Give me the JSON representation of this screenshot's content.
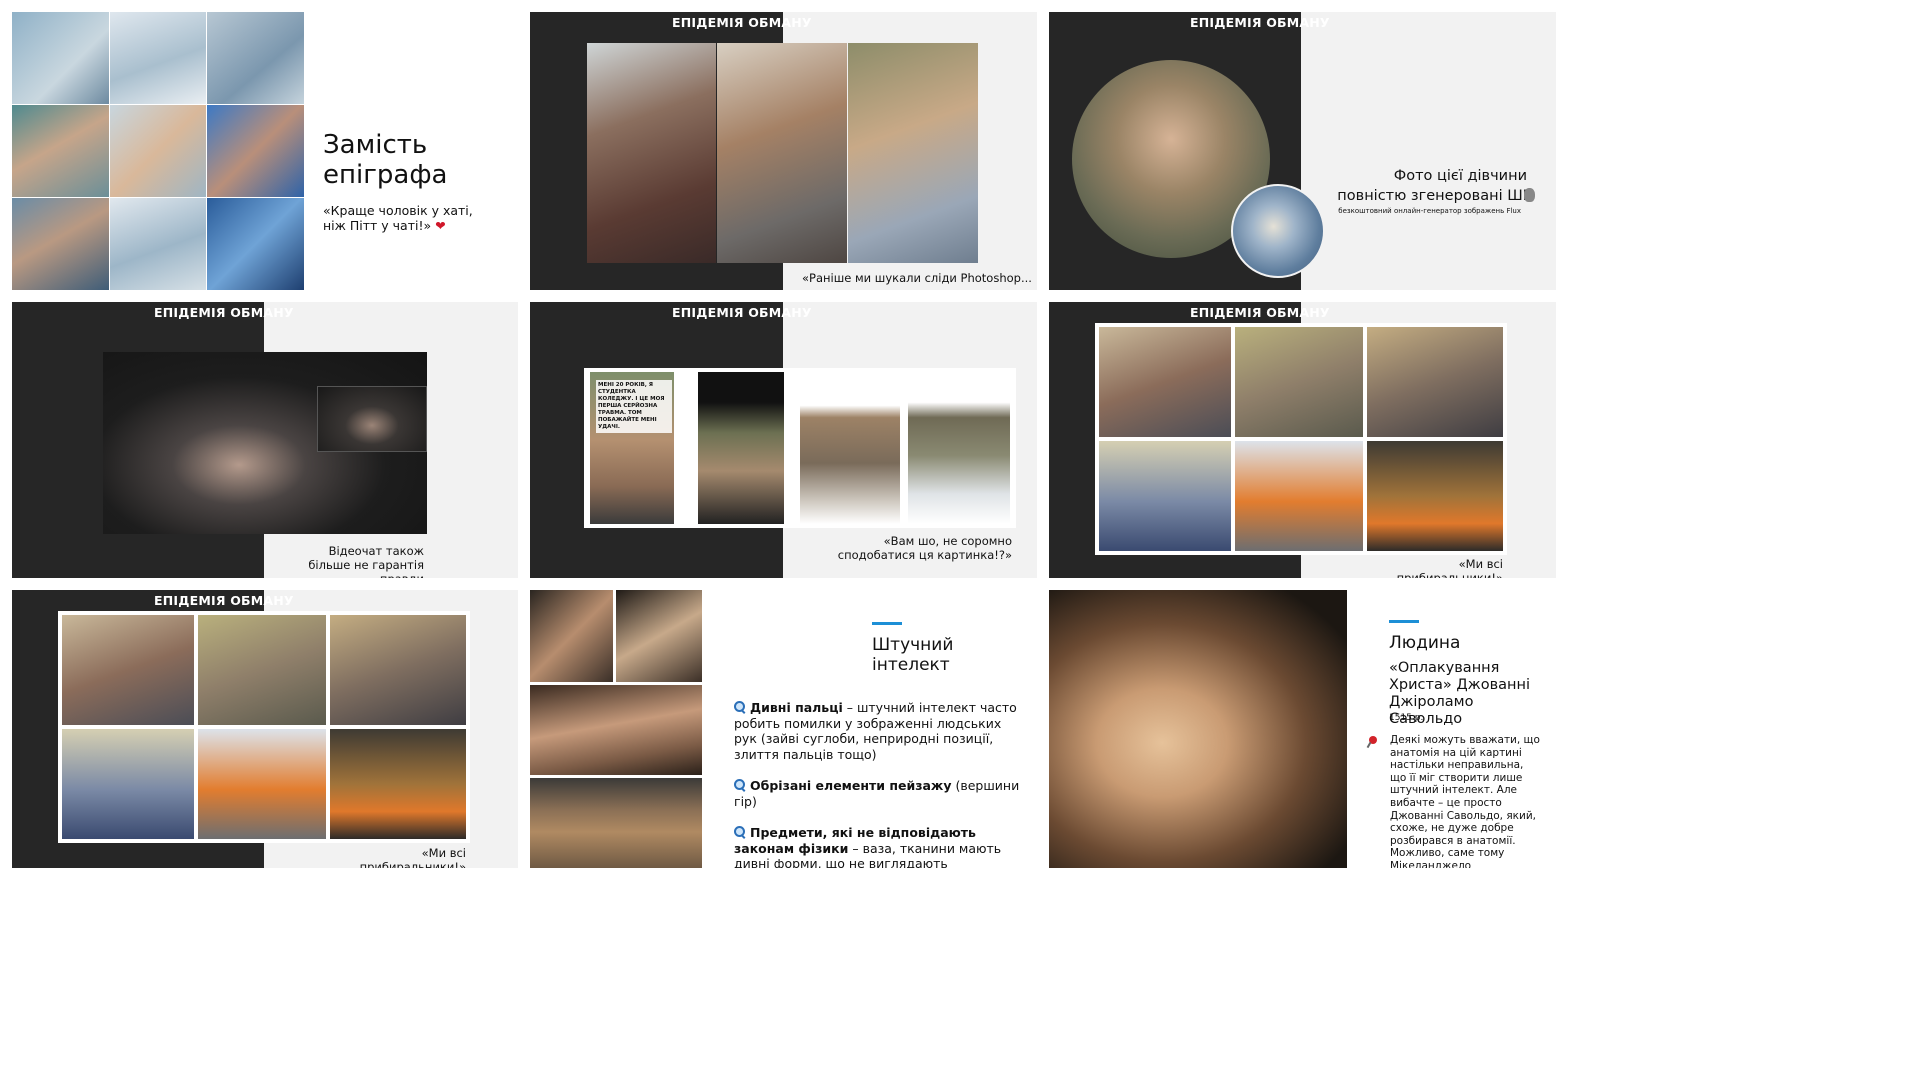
{
  "slides": {
    "s1": {
      "title": "Замість епіграфа",
      "quote": "«Краще чоловік у хаті, ніж Пітт у чаті!»",
      "heart": "❤"
    },
    "s2": {
      "header": "ЕПІДЕМІЯ ОБМАНУ",
      "caption": "«Раніше ми шукали сліди Photoshop..."
    },
    "s3": {
      "header": "ЕПІДЕМІЯ ОБМАНУ",
      "headline": "Фото цієї дівчини повністю згенеровані ШІ",
      "note": "безкоштовний онлайн-генератор зображень Flux"
    },
    "s4": {
      "header": "ЕПІДЕМІЯ ОБМАНУ",
      "caption": "Відеочат також більше не гарантія правди"
    },
    "s5": {
      "header": "ЕПІДЕМІЯ ОБМАНУ",
      "caption": "«Вам шо, не соромно сподобатися ця картинка!?»",
      "post1_text": "МЕНІ 20 РОКІВ, Я СТУДЕНТКА КОЛЕДЖУ. І ЦЕ МОЯ ПЕРША СЕРЙОЗНА ТРАВМА. ТОМ ПОБАЖАЙТЕ МЕНІ УДАЧІ."
    },
    "s6": {
      "header": "ЕПІДЕМІЯ ОБМАНУ",
      "caption": "«Ми всі прибиральники!»"
    },
    "s7": {
      "header": "ЕПІДЕМІЯ ОБМАНУ",
      "caption": "«Ми всі прибиральники!»"
    },
    "s8": {
      "title": "Штучний інтелект",
      "items": [
        {
          "bold": "Дивні пальці",
          "rest": " – штучний інтелект часто робить помилки у зображенні людських рук (зайві суглоби, неприродні позиції, злиття пальців тощо)"
        },
        {
          "bold": "Обрізані елементи пейзажу",
          "rest": " (вершини гір)"
        },
        {
          "bold": "Предмети, які не відповідають законам фізики",
          "rest": " – ваза, тканини мають дивні форми, що не виглядають природньо"
        }
      ]
    },
    "s9": {
      "title": "Людина",
      "painting": "«Оплакування Христа» Джованні Джіроламо Савольдо",
      "year": "1515 р.",
      "note": "Деякі можуть вважати, що анатомія на цій картині настільки неправильна, що її міг створити лише штучний інтелект. Але вибачте – це просто Джованні Савольдо, який, схоже, не дуже добре розбирався в анатомії. Можливо, саме тому Мікеланджело доводилося розтинати всі ті трупи"
    }
  },
  "colors": {
    "dark": "#262626",
    "light": "#f2f2f2",
    "accent": "#1d8fd6"
  }
}
